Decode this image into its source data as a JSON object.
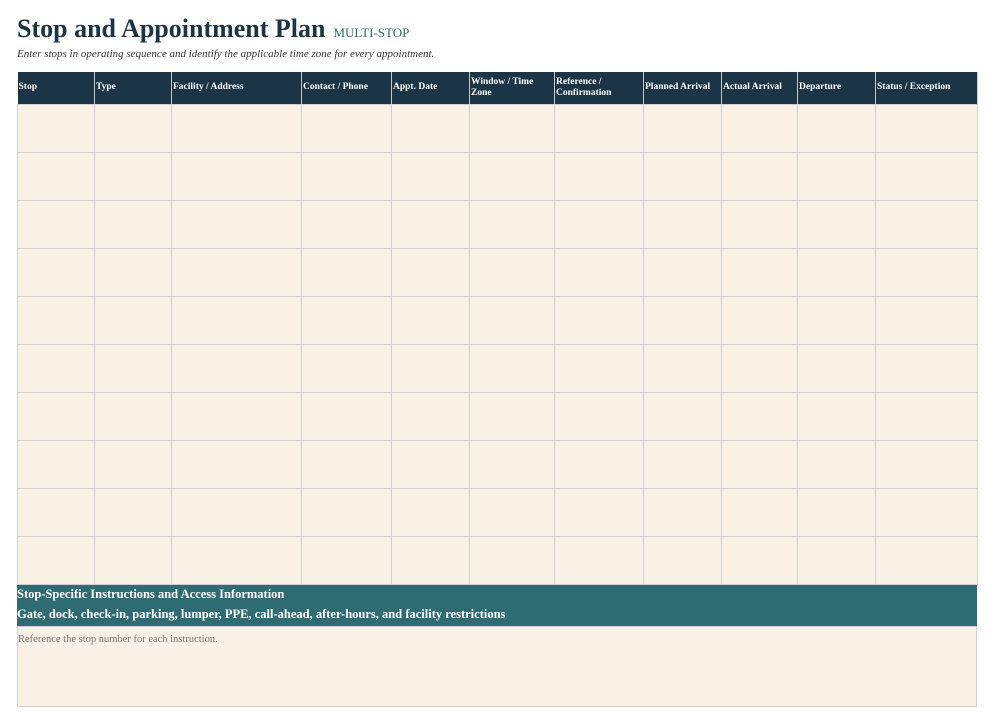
{
  "header": {
    "title": "Stop and Appointment Plan",
    "badge": "MULTI-STOP",
    "subtitle": "Enter stops in operating sequence and identify the applicable time zone for every appointment."
  },
  "table": {
    "columns": [
      "Stop",
      "Type",
      "Facility / Address",
      "Contact / Phone",
      "Appt. Date",
      "Window / Time Zone",
      "Reference / Confirmation",
      "Planned Arrival",
      "Actual Arrival",
      "Departure",
      "Status / Exception"
    ],
    "row_count": 10
  },
  "instructions": {
    "title": "Stop-Specific Instructions and Access Information",
    "subtitle": "Gate, dock, check-in, parking, lumper, PPE, call-ahead, after-hours, and facility restrictions",
    "hint": "Reference the stop number for each instruction."
  },
  "colors": {
    "header_bg": "#1b3446",
    "accent": "#2e6b73",
    "cell_bg": "#faf1e6"
  }
}
